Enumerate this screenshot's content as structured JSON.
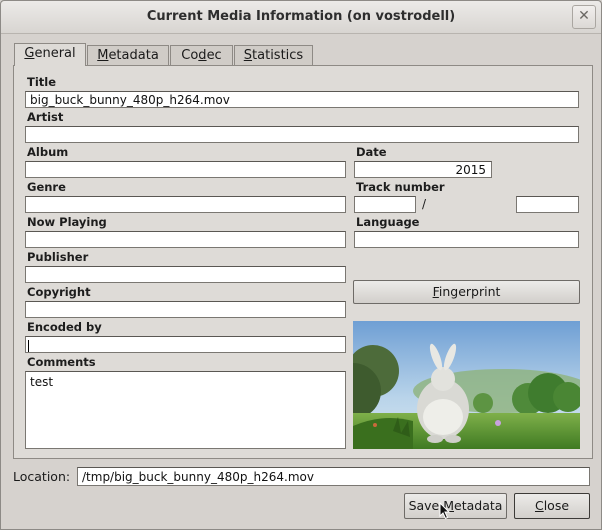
{
  "window": {
    "title": "Current Media Information (on vostrodell)",
    "close_glyph": "✕"
  },
  "tabs": [
    {
      "label_pre": "",
      "accel": "G",
      "label_post": "eneral"
    },
    {
      "label_pre": "",
      "accel": "M",
      "label_post": "etadata"
    },
    {
      "label_pre": "Co",
      "accel": "d",
      "label_post": "ec"
    },
    {
      "label_pre": "",
      "accel": "S",
      "label_post": "tatistics"
    }
  ],
  "fields": {
    "title": {
      "label": "Title",
      "value": "big_buck_bunny_480p_h264.mov"
    },
    "artist": {
      "label": "Artist",
      "value": ""
    },
    "album": {
      "label": "Album",
      "value": ""
    },
    "date": {
      "label": "Date",
      "value": "2015"
    },
    "genre": {
      "label": "Genre",
      "value": ""
    },
    "track": {
      "label": "Track number",
      "value": "",
      "separator": "/",
      "total": ""
    },
    "now_playing": {
      "label": "Now Playing",
      "value": ""
    },
    "language": {
      "label": "Language",
      "value": ""
    },
    "publisher": {
      "label": "Publisher",
      "value": ""
    },
    "copyright": {
      "label": "Copyright",
      "value": ""
    },
    "encoded_by": {
      "label": "Encoded by",
      "value": ""
    },
    "comments": {
      "label": "Comments",
      "value": "test"
    }
  },
  "fingerprint": {
    "accel": "F",
    "rest": "ingerprint"
  },
  "location": {
    "label": "Location:",
    "value": "/tmp/big_buck_bunny_480p_h264.mov"
  },
  "buttons": {
    "save_pre": "Save ",
    "save_accel": "M",
    "save_post": "etadata",
    "close_accel": "C",
    "close_post": "lose"
  },
  "icons": {
    "close": "close-icon",
    "cursor": "mouse-pointer-icon"
  }
}
